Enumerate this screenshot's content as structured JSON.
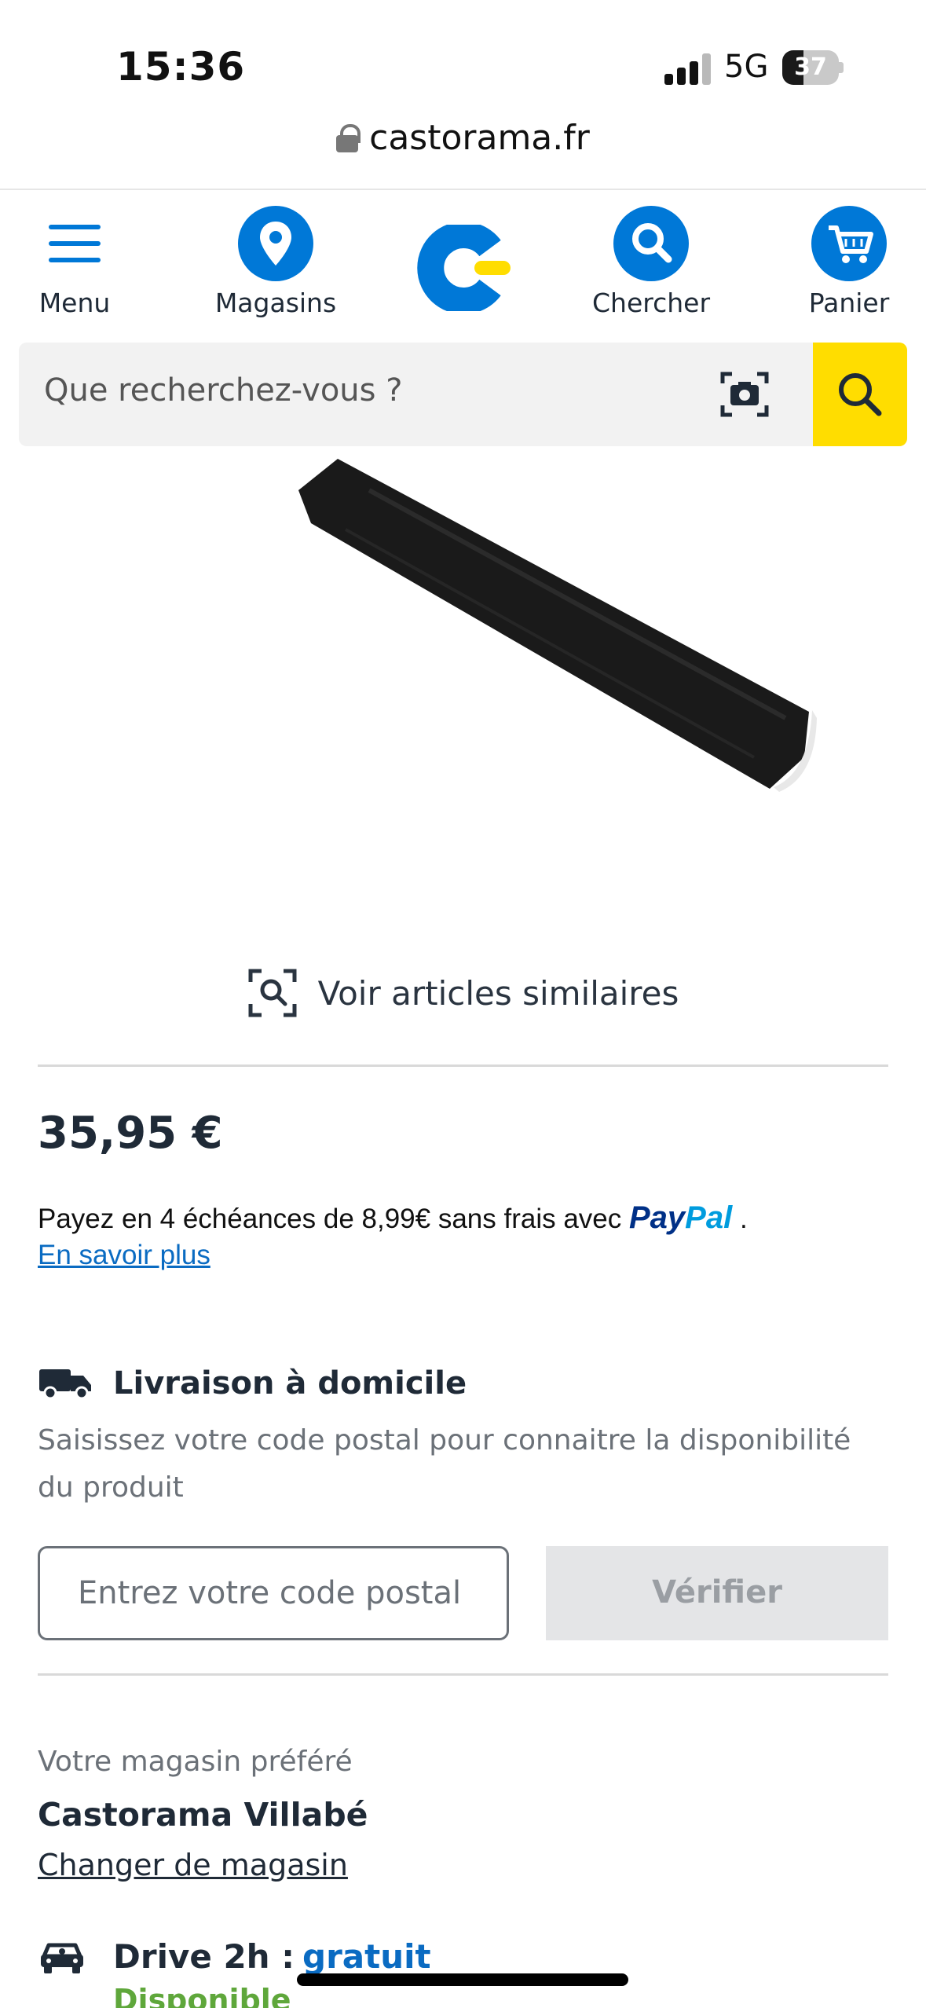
{
  "status_bar": {
    "time": "15:36",
    "network": "5G",
    "battery": "37",
    "battery_level": 0.37
  },
  "browser": {
    "url": "castorama.fr"
  },
  "nav": {
    "menu_label": "Menu",
    "stores_label": "Magasins",
    "search_label": "Chercher",
    "cart_label": "Panier"
  },
  "search": {
    "placeholder": "Que recherchez-vous ?"
  },
  "product": {
    "similar_label": "Voir articles similaires",
    "price": "35,95 €",
    "paypal_text": "Payez en 4 échéances de 8,99€ sans frais avec",
    "paypal_brand_1": "Pay",
    "paypal_brand_2": "Pal",
    "paypal_end": ".",
    "learn_more": "En savoir plus"
  },
  "delivery": {
    "title": "Livraison à domicile",
    "description": "Saisissez votre code postal pour connaitre la disponibilité du produit",
    "postal_placeholder": "Entrez votre code postal",
    "verify_label": "Vérifier"
  },
  "store": {
    "fav_label": "Votre magasin préféré",
    "name": "Castorama Villabé",
    "change_label": "Changer de magasin"
  },
  "drive": {
    "label": "Drive 2h :",
    "price": "gratuit",
    "status": "Disponible"
  },
  "colors": {
    "brand_blue": "#0078d7",
    "search_yellow": "#ffdd00",
    "available_green": "#5fa73b",
    "link_blue": "#0a6bc2"
  }
}
